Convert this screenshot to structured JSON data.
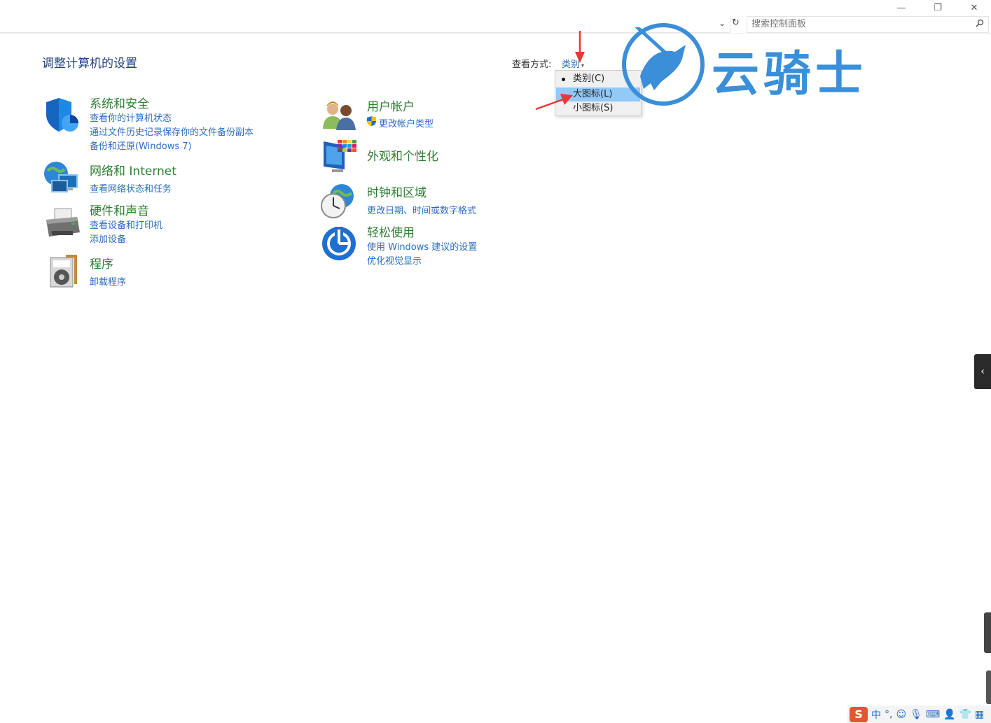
{
  "window": {
    "minimize_glyph": "—",
    "maximize_glyph": "❐",
    "close_glyph": "✕"
  },
  "address": {
    "dropdown_glyph": "⌄",
    "refresh_glyph": "↻",
    "search_placeholder": "搜索控制面板"
  },
  "header": {
    "title": "调整计算机的设置",
    "view_by_label": "查看方式:",
    "view_by_value": "类别"
  },
  "view_menu": {
    "items": [
      {
        "label": "类别(C)",
        "selected": true
      },
      {
        "label": "大图标(L)",
        "highlighted": true
      },
      {
        "label": "小图标(S)"
      }
    ]
  },
  "watermark": {
    "text": "云骑士"
  },
  "categories_left": [
    {
      "title": "系统和安全",
      "links": [
        "查看你的计算机状态",
        "通过文件历史记录保存你的文件备份副本",
        "备份和还原(Windows 7)"
      ],
      "icon": "shield-icon"
    },
    {
      "title": "网络和 Internet",
      "links": [
        "查看网络状态和任务"
      ],
      "icon": "network-globe-icon"
    },
    {
      "title": "硬件和声音",
      "links": [
        "查看设备和打印机",
        "添加设备"
      ],
      "icon": "printer-icon"
    },
    {
      "title": "程序",
      "links": [
        "卸载程序"
      ],
      "icon": "programs-disc-icon"
    }
  ],
  "categories_right": [
    {
      "title": "用户帐户",
      "links": [
        "更改帐户类型"
      ],
      "icon": "users-icon"
    },
    {
      "title": "外观和个性化",
      "links": [],
      "icon": "monitor-palette-icon"
    },
    {
      "title": "时钟和区域",
      "links": [
        "更改日期、时间或数字格式"
      ],
      "icon": "clock-globe-icon"
    },
    {
      "title": "轻松使用",
      "links": [
        "使用 Windows 建议的设置",
        "优化视觉显示"
      ],
      "icon": "ease-of-access-icon"
    }
  ],
  "side_tab": {
    "glyph": "‹"
  },
  "ime": {
    "logo": "S",
    "mode": "中",
    "punct": "°,"
  },
  "colors": {
    "link": "#2b6cc4",
    "category_title": "#2e7d32",
    "page_title": "#1e3f7a",
    "menu_highlight": "#91c9f7",
    "watermark": "#3a8fd9",
    "arrow": "#e53935"
  }
}
